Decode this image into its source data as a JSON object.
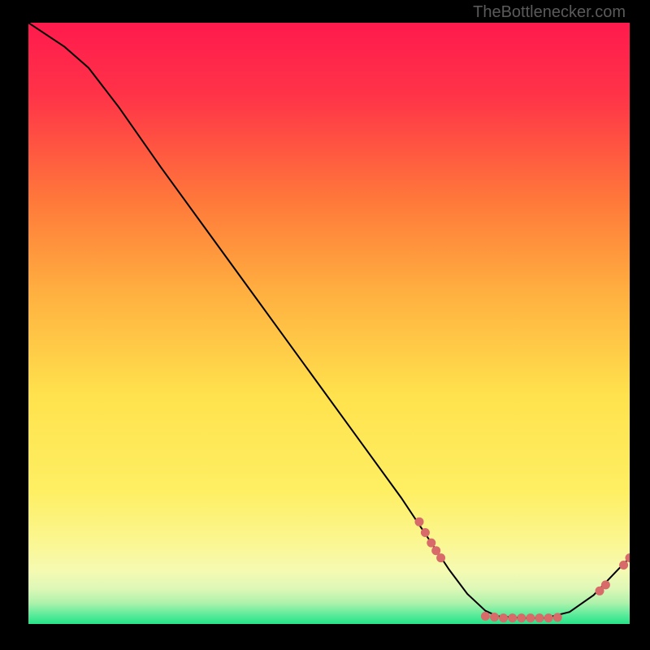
{
  "watermark": "TheBottlenecker.com",
  "chart_data": {
    "type": "line",
    "title": "",
    "xlabel": "",
    "ylabel": "",
    "xlim": [
      0,
      100
    ],
    "ylim": [
      0,
      100
    ],
    "background_gradient": {
      "top_upper": "#ff1a4d",
      "orange": "#ff9a33",
      "yellow": "#ffe94d",
      "light_yellow": "#fdfca0",
      "pale_green": "#c9f6b3",
      "green": "#2ee88f"
    },
    "curve": [
      {
        "x": 0,
        "y": 100
      },
      {
        "x": 6,
        "y": 96
      },
      {
        "x": 10,
        "y": 92.5
      },
      {
        "x": 15,
        "y": 86
      },
      {
        "x": 22,
        "y": 76
      },
      {
        "x": 30,
        "y": 65
      },
      {
        "x": 38,
        "y": 54
      },
      {
        "x": 46,
        "y": 43
      },
      {
        "x": 54,
        "y": 32
      },
      {
        "x": 62,
        "y": 21
      },
      {
        "x": 67,
        "y": 13.5
      },
      {
        "x": 70,
        "y": 9
      },
      {
        "x": 73,
        "y": 5
      },
      {
        "x": 76,
        "y": 2.2
      },
      {
        "x": 78,
        "y": 1.3
      },
      {
        "x": 82,
        "y": 1.0
      },
      {
        "x": 86,
        "y": 1.0
      },
      {
        "x": 90,
        "y": 2.0
      },
      {
        "x": 94,
        "y": 4.8
      },
      {
        "x": 98,
        "y": 9.0
      },
      {
        "x": 100,
        "y": 11.0
      }
    ],
    "markers": [
      {
        "x": 65,
        "y": 17
      },
      {
        "x": 66,
        "y": 15.2
      },
      {
        "x": 67,
        "y": 13.5
      },
      {
        "x": 67.8,
        "y": 12.2
      },
      {
        "x": 68.6,
        "y": 11
      },
      {
        "x": 76,
        "y": 1.3
      },
      {
        "x": 77.5,
        "y": 1.15
      },
      {
        "x": 79,
        "y": 1.0
      },
      {
        "x": 80.5,
        "y": 1.0
      },
      {
        "x": 82,
        "y": 1.0
      },
      {
        "x": 83.5,
        "y": 1.0
      },
      {
        "x": 85,
        "y": 1.0
      },
      {
        "x": 86.5,
        "y": 1.0
      },
      {
        "x": 88,
        "y": 1.1
      },
      {
        "x": 95,
        "y": 5.5
      },
      {
        "x": 96,
        "y": 6.5
      },
      {
        "x": 99,
        "y": 9.8
      },
      {
        "x": 100,
        "y": 11.0
      }
    ],
    "marker_color": "#d86a6a",
    "marker_radius": 5.5,
    "line_color": "#000000",
    "line_width": 2
  }
}
